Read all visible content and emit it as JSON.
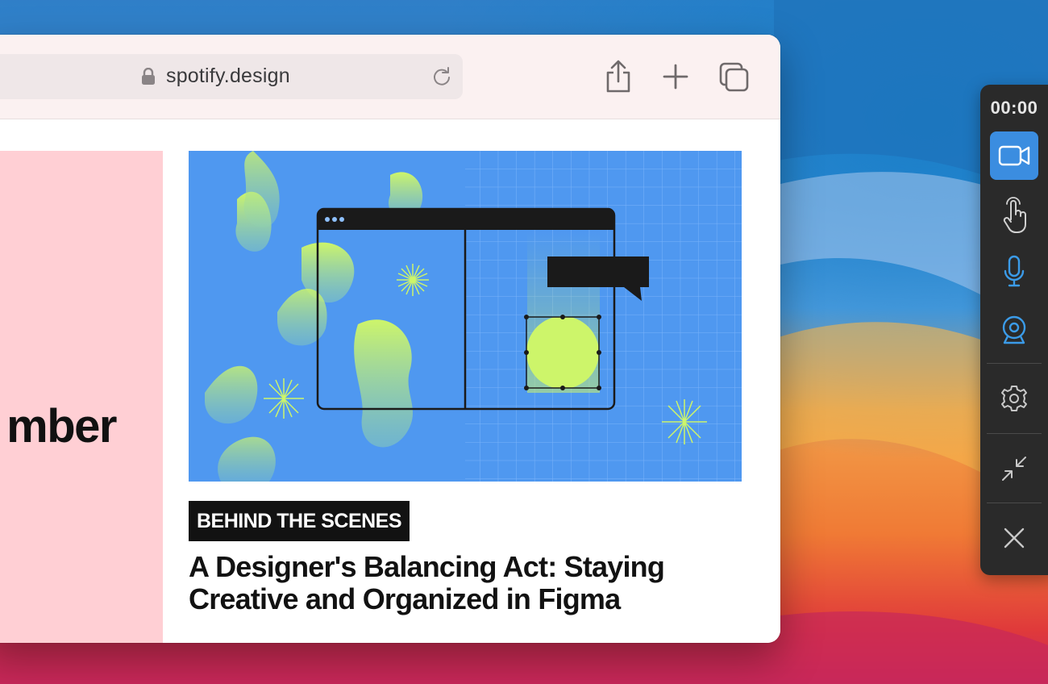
{
  "browser": {
    "url": "spotify.design",
    "pink_card_text": "mber"
  },
  "article": {
    "tag": "BEHIND THE SCENES",
    "headline": "A Designer's Balancing Act: Staying Creative and Organized in Figma"
  },
  "recorder": {
    "timer": "00:00",
    "accent_color": "#3b8de0"
  },
  "icons": [
    "lock-icon",
    "reload-icon",
    "share-icon",
    "plus-icon",
    "tabs-icon",
    "camera-icon",
    "touch-icon",
    "microphone-icon",
    "webcam-icon",
    "gear-icon",
    "minimize-icon",
    "close-icon"
  ]
}
